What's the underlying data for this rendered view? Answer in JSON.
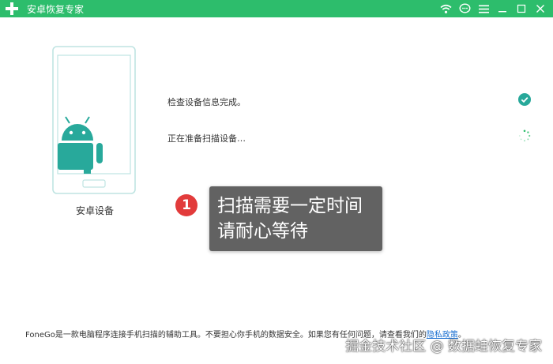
{
  "window": {
    "title": "安卓恢复专家",
    "accent_color": "#2dbd6c",
    "icons": {
      "logo": "plus-logo-icon",
      "wifi": "wifi-icon",
      "feedback": "chat-bubble-icon",
      "menu": "hamburger-menu-icon",
      "minimize": "minimize-icon",
      "maximize": "maximize-icon",
      "close": "close-icon"
    }
  },
  "device": {
    "caption": "安卓设备",
    "icon": "android-robot-icon"
  },
  "status": [
    {
      "text": "检查设备信息完成。",
      "state": "done",
      "icon": "check-circle-icon"
    },
    {
      "text": "正在准备扫描设备…",
      "state": "in_progress",
      "icon": "loading-spinner-icon"
    }
  ],
  "annotation": {
    "number": "1",
    "badge_color": "#e23b3b",
    "text": "扫描需要一定时间请耐心等待"
  },
  "footer": {
    "text": "FoneGo是一款电脑程序连接手机扫描的辅助工具。不要担心你手机的数据安全。如果您有任何问题，请查看我们的",
    "link_text": "隐私政策",
    "suffix": "。"
  },
  "watermark": "掘金技术社区 @ 数据蛙恢复专家"
}
